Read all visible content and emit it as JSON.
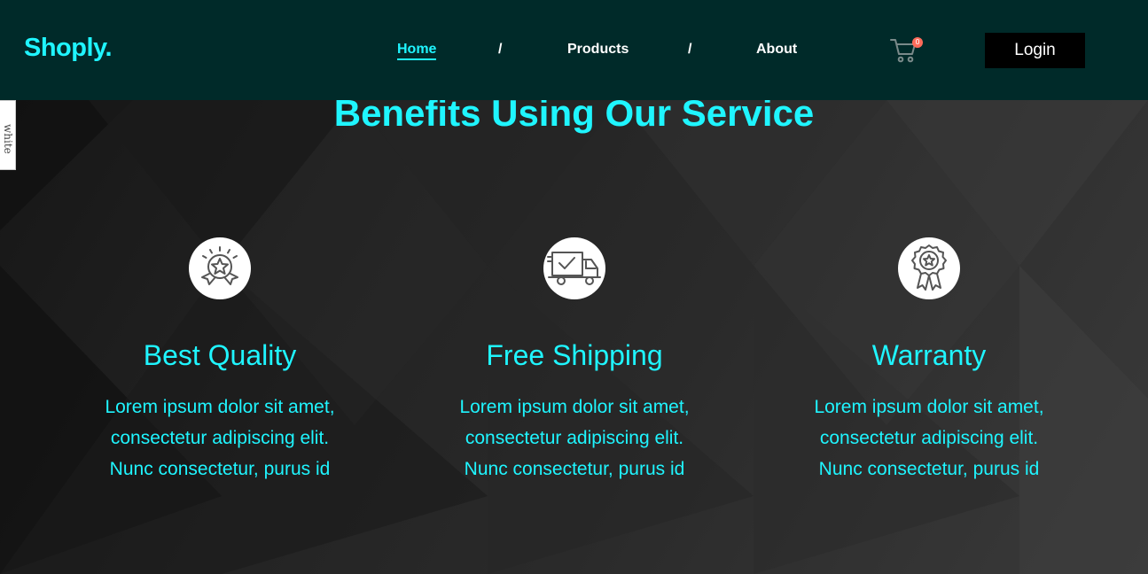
{
  "header": {
    "logo": "Shoply.",
    "nav": [
      {
        "label": "Home",
        "active": true
      },
      {
        "label": "Products",
        "active": false
      },
      {
        "label": "About",
        "active": false
      }
    ],
    "separator": "/",
    "cart_count": "0",
    "cart_icon": "shopping-cart-icon",
    "login_label": "Login"
  },
  "side_tab": {
    "label": "white"
  },
  "section": {
    "title": "Benefits Using Our Service",
    "features": [
      {
        "icon": "quality-badge-icon",
        "title": "Best Quality",
        "text": "Lorem ipsum dolor sit amet, consectetur adipiscing elit. Nunc consectetur, purus id"
      },
      {
        "icon": "delivery-truck-icon",
        "title": "Free Shipping",
        "text": "Lorem ipsum dolor sit amet, consectetur adipiscing elit. Nunc consectetur, purus id"
      },
      {
        "icon": "warranty-ribbon-icon",
        "title": "Warranty",
        "text": "Lorem ipsum dolor sit amet, consectetur adipiscing elit. Nunc consectetur, purus id"
      }
    ]
  },
  "colors": {
    "accent": "#1ff5ff",
    "header_bg": "#002a29",
    "button_bg": "#000000",
    "badge": "#ff6b5a"
  }
}
